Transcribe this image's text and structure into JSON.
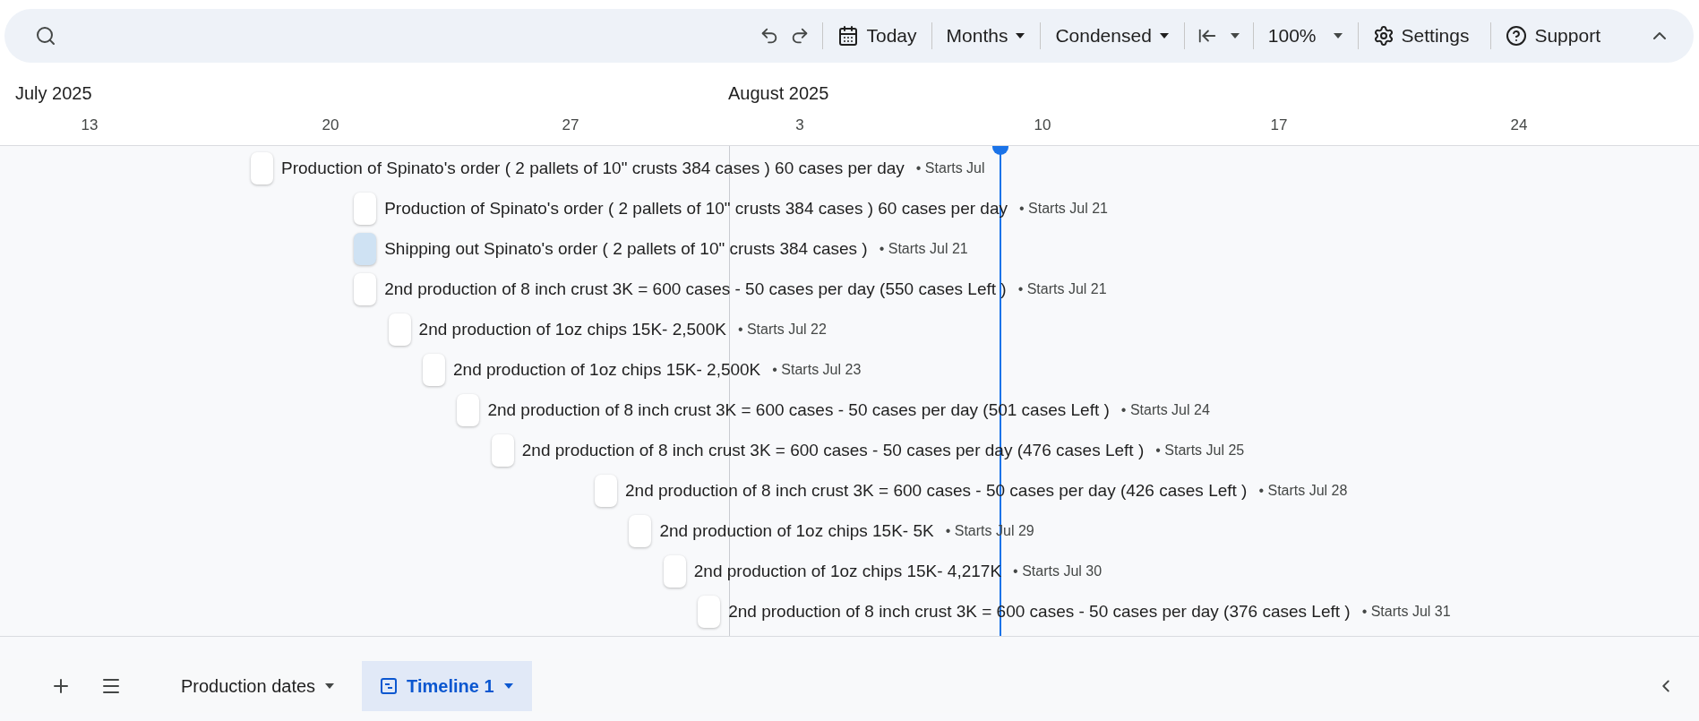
{
  "toolbar": {
    "today": "Today",
    "view": "Months",
    "density": "Condensed",
    "zoom": "100%",
    "settings": "Settings",
    "support": "Support"
  },
  "timeline": {
    "months": [
      {
        "label": "July 2025"
      },
      {
        "label": "August 2025"
      }
    ],
    "ticks": [
      "13",
      "20",
      "27",
      "3",
      "10",
      "17",
      "24"
    ],
    "rows": [
      {
        "title": "Production of Spinato's order ( 2 pallets of 10\" crusts 384 cases ) 60 cases per day",
        "meta": "• Starts Jul",
        "color": "#ffffff"
      },
      {
        "title": "Production of Spinato's order ( 2 pallets of 10\" crusts 384 cases ) 60 cases per day",
        "meta": "• Starts Jul 21",
        "color": "#ffffff"
      },
      {
        "title": "Shipping out Spinato's order ( 2 pallets of 10\" crusts 384 cases )",
        "meta": "• Starts Jul 21",
        "color": "#cfe2f3"
      },
      {
        "title": "2nd production of 8 inch crust 3K = 600 cases - 50 cases per day (550 cases Left )",
        "meta": "• Starts Jul 21",
        "color": "#ffffff"
      },
      {
        "title": "2nd production of 1oz chips 15K- 2,500K",
        "meta": "• Starts Jul 22",
        "color": "#ffffff"
      },
      {
        "title": "2nd production of 1oz chips 15K- 2,500K",
        "meta": "• Starts Jul 23",
        "color": "#ffffff"
      },
      {
        "title": "2nd production of 8 inch crust 3K = 600 cases - 50 cases per day (501 cases Left )",
        "meta": "• Starts Jul 24",
        "color": "#ffffff"
      },
      {
        "title": "2nd production of 8 inch crust 3K = 600 cases - 50 cases per day (476 cases Left )",
        "meta": "• Starts Jul 25",
        "color": "#ffffff"
      },
      {
        "title": "2nd production of 8 inch crust 3K = 600 cases - 50 cases per day (426 cases Left )",
        "meta": "• Starts Jul 28",
        "color": "#ffffff"
      },
      {
        "title": "2nd production of 1oz chips 15K- 5K",
        "meta": "• Starts Jul 29",
        "color": "#ffffff"
      },
      {
        "title": "2nd production of 1oz chips 15K- 4,217K",
        "meta": "• Starts Jul 30",
        "color": "#ffffff"
      },
      {
        "title": "2nd production of 8 inch crust 3K = 600 cases - 50 cases per day (376 cases Left )",
        "meta": "• Starts Jul 31",
        "color": "#ffffff"
      }
    ]
  },
  "sheets": [
    {
      "label": "Production dates",
      "selected": false
    },
    {
      "label": "Timeline 1",
      "selected": true
    }
  ]
}
